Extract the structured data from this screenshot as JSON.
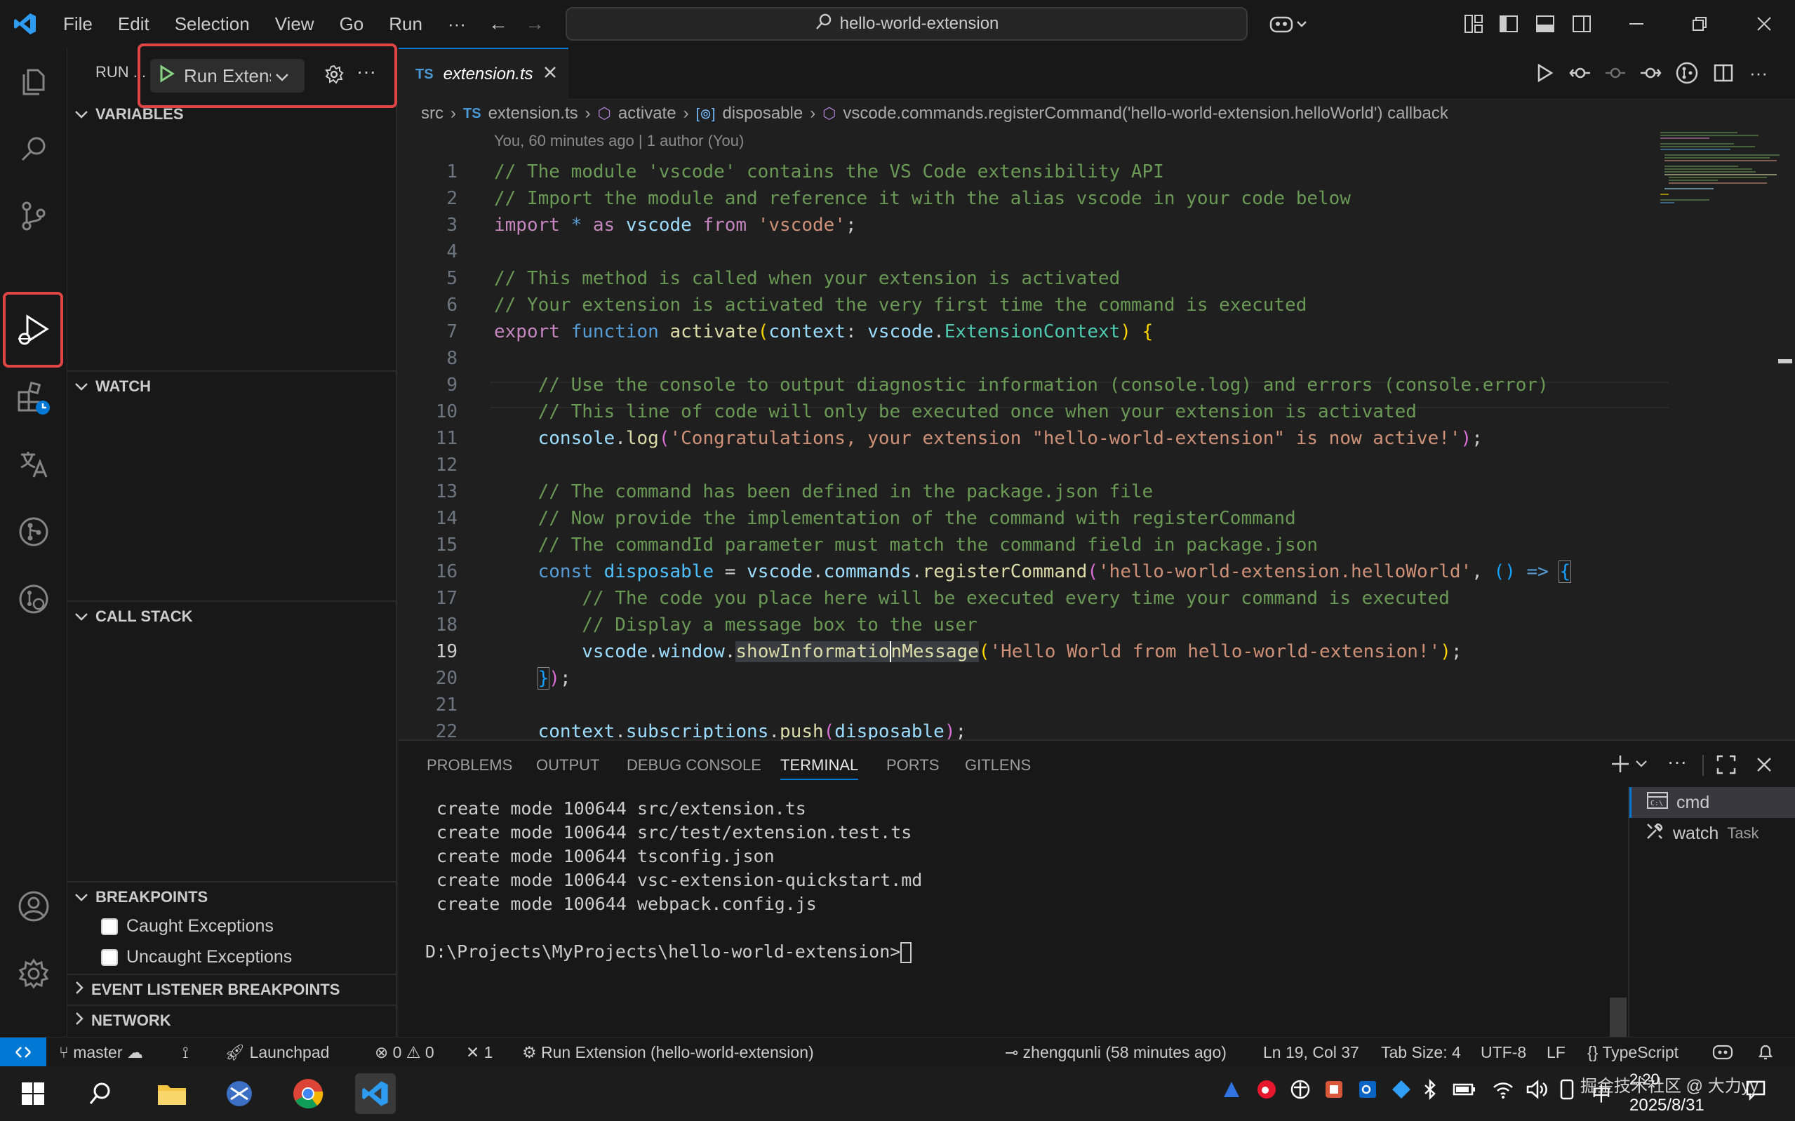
{
  "window": {
    "menu": [
      "File",
      "Edit",
      "Selection",
      "View",
      "Go",
      "Run",
      "···"
    ],
    "search_text": "hello-world-extension"
  },
  "sidebar": {
    "run_label": "RUN ...",
    "run_config": "Run Extens",
    "sections": {
      "variables": "VARIABLES",
      "watch": "WATCH",
      "call_stack": "CALL STACK",
      "breakpoints": "BREAKPOINTS",
      "event_listener": "EVENT LISTENER BREAKPOINTS",
      "network": "NETWORK"
    },
    "breakpoints": [
      "Caught Exceptions",
      "Uncaught Exceptions"
    ]
  },
  "editor": {
    "tab_badge": "TS",
    "tab_label": "extension.ts",
    "breadcrumb": {
      "folder": "src",
      "file": "extension.ts",
      "fn": "activate",
      "var": "disposable",
      "callback": "vscode.commands.registerCommand('hello-world-extension.helloWorld') callback"
    },
    "blame": "You, 60 minutes ago | 1 author (You)",
    "cursor": "Ln 19, Col 37"
  },
  "panel": {
    "tabs": [
      "PROBLEMS",
      "OUTPUT",
      "DEBUG CONSOLE",
      "TERMINAL",
      "PORTS",
      "GITLENS"
    ],
    "active_tab": "TERMINAL",
    "terminal_lines": [
      "create mode 100644 src/extension.ts",
      "create mode 100644 src/test/extension.test.ts",
      "create mode 100644 tsconfig.json",
      "create mode 100644 vsc-extension-quickstart.md",
      "create mode 100644 webpack.config.js"
    ],
    "prompt": "D:\\Projects\\MyProjects\\hello-world-extension>",
    "terminals": [
      {
        "name": "cmd",
        "detail": ""
      },
      {
        "name": "watch",
        "detail": "Task"
      }
    ]
  },
  "statusbar": {
    "branch": "master",
    "launchpad": "Launchpad",
    "errors": "0",
    "warnings": "0",
    "ports": "1",
    "debug": "Run Extension (hello-world-extension)",
    "blame": "zhengqunli (58 minutes ago)",
    "position": "Ln 19, Col 37",
    "tab_size": "Tab Size: 4",
    "encoding": "UTF-8",
    "eol": "LF",
    "language": "TypeScript"
  },
  "taskbar": {
    "ime": "中",
    "date": "2025/8/31",
    "watermark": "掘金技术社区 @ 大力yy",
    "clock_partial": "2:20"
  },
  "colors": {
    "accent": "#0078d4",
    "highlight": "#e04545",
    "run_green": "#89d185"
  }
}
